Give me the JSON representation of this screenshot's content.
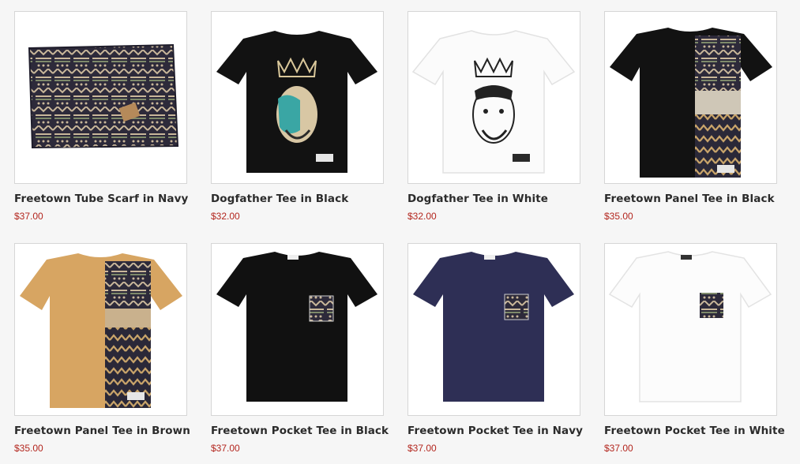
{
  "colors": {
    "price": "#b3261e",
    "name": "#2b2b2b",
    "border": "#d6d6d6"
  },
  "products": [
    {
      "name": "Freetown Tube Scarf in Navy",
      "price": "$37.00",
      "image": "patterned-scarf"
    },
    {
      "name": "Dogfather Tee in Black",
      "price": "$32.00",
      "image": "black-tee-portrait"
    },
    {
      "name": "Dogfather Tee in White",
      "price": "$32.00",
      "image": "white-tee-portrait"
    },
    {
      "name": "Freetown Panel Tee in Black",
      "price": "$35.00",
      "image": "black-panel-tee"
    },
    {
      "name": "Freetown Panel Tee in Brown",
      "price": "$35.00",
      "image": "brown-panel-tee"
    },
    {
      "name": "Freetown Pocket Tee in Black",
      "price": "$37.00",
      "image": "black-pocket-tee"
    },
    {
      "name": "Freetown Pocket Tee in Navy",
      "price": "$37.00",
      "image": "navy-pocket-tee"
    },
    {
      "name": "Freetown Pocket Tee in White",
      "price": "$37.00",
      "image": "white-pocket-tee"
    }
  ]
}
